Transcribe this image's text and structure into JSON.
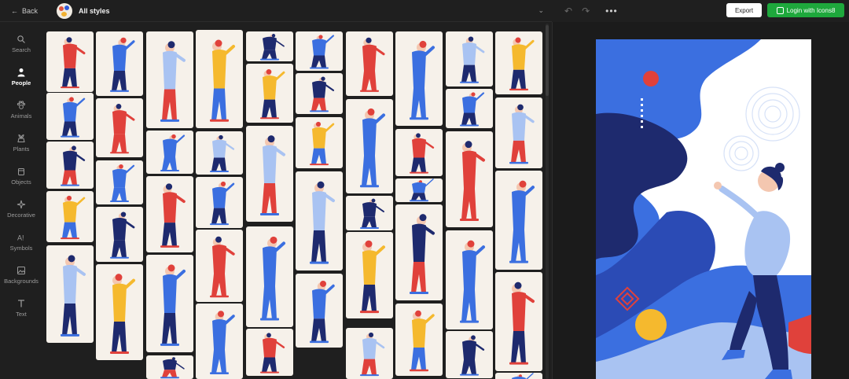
{
  "topbar": {
    "back_label": "Back",
    "style_label": "All styles",
    "export_label": "Export",
    "login_label": "Login with Icons8"
  },
  "nav": {
    "items": [
      {
        "label": "Search",
        "icon": "search-icon"
      },
      {
        "label": "People",
        "icon": "person-icon",
        "active": true
      },
      {
        "label": "Animals",
        "icon": "paw-icon"
      },
      {
        "label": "Plants",
        "icon": "plant-icon"
      },
      {
        "label": "Objects",
        "icon": "cube-icon"
      },
      {
        "label": "Decorative",
        "icon": "sparkle-icon"
      },
      {
        "label": "Symbols",
        "icon": "symbols-icon"
      },
      {
        "label": "Backgrounds",
        "icon": "image-icon"
      },
      {
        "label": "Text",
        "icon": "text-icon"
      }
    ]
  },
  "colors": {
    "accent_green": "#1ea83c",
    "illustration_blue": "#3b6fe0",
    "illustration_navy": "#1e2a6e",
    "illustration_red": "#e0413b",
    "illustration_yellow": "#f5b92e",
    "card_bg": "#f6f1ea"
  }
}
